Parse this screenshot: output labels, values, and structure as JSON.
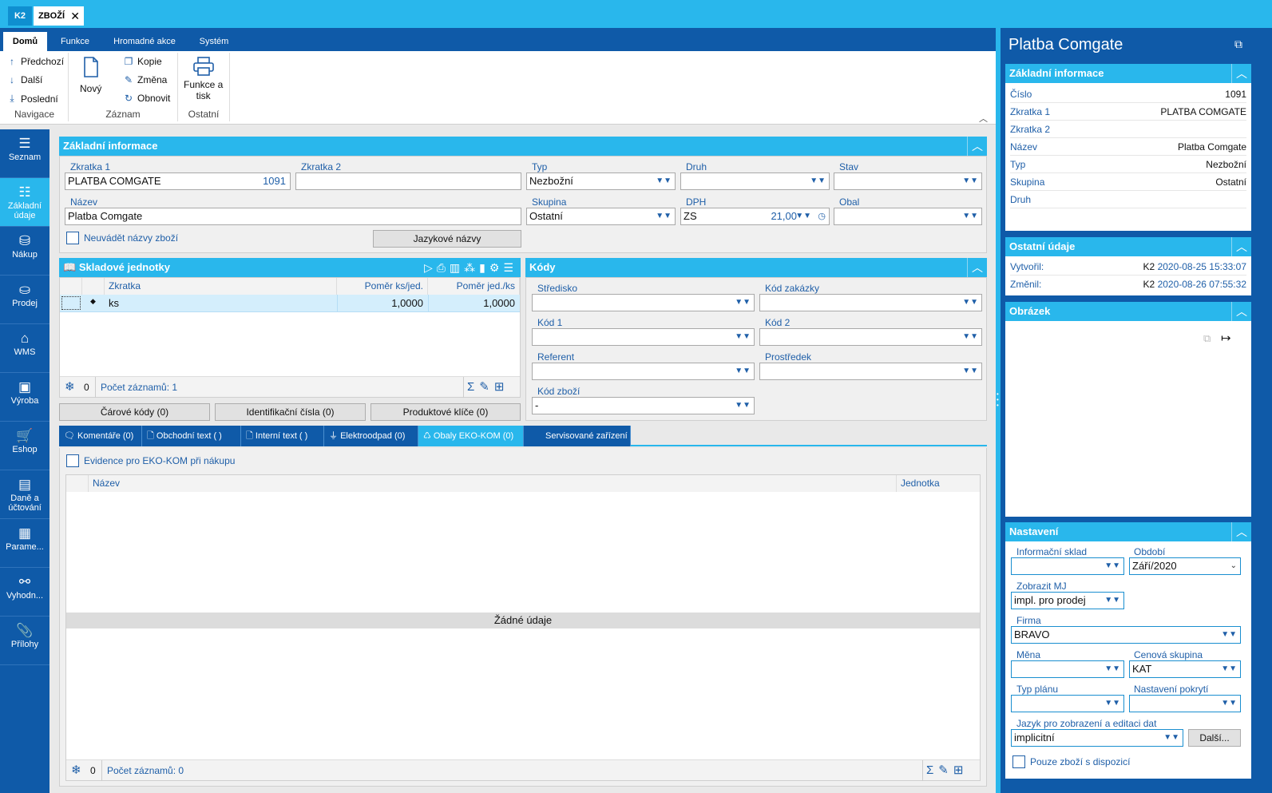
{
  "window_tabs": [
    {
      "label": "K2"
    },
    {
      "label": "ZBOŽÍ"
    }
  ],
  "ribbon": {
    "tabs": [
      "Domů",
      "Funkce",
      "Hromadné akce",
      "Systém"
    ],
    "nav": {
      "prev": "Předchozí",
      "next": "Další",
      "last": "Poslední",
      "group": "Navigace"
    },
    "record": {
      "new": "Nový",
      "copy": "Kopie",
      "change": "Změna",
      "refresh": "Obnovit",
      "group": "Záznam"
    },
    "other": {
      "print_line1": "Funkce a",
      "print_line2": "tisk",
      "group": "Ostatní"
    }
  },
  "nav": [
    {
      "label": "Seznam",
      "icon": "list-icon"
    },
    {
      "label": "Základní údaje",
      "icon": "list-detail-icon"
    },
    {
      "label": "Nákup",
      "icon": "purchase-icon"
    },
    {
      "label": "Prodej",
      "icon": "sale-icon"
    },
    {
      "label": "WMS",
      "icon": "warehouse-icon"
    },
    {
      "label": "Výroba",
      "icon": "production-icon"
    },
    {
      "label": "Eshop",
      "icon": "cart-icon"
    },
    {
      "label": "Daně a účtování",
      "icon": "accounting-icon"
    },
    {
      "label": "Parame...",
      "icon": "parameters-icon"
    },
    {
      "label": "Vyhodn...",
      "icon": "evaluation-icon"
    },
    {
      "label": "Přílohy",
      "icon": "attachment-icon"
    }
  ],
  "basic": {
    "title": "Základní informace",
    "zkratka1_label": "Zkratka 1",
    "zkratka1_value": "PLATBA COMGATE",
    "zkratka1_num": "1091",
    "zkratka2_label": "Zkratka 2",
    "typ_label": "Typ",
    "typ_value": "Nezbožní",
    "druh_label": "Druh",
    "stav_label": "Stav",
    "nazev_label": "Název",
    "nazev_value": "Platba Comgate",
    "skupina_label": "Skupina",
    "skupina_value": "Ostatní",
    "dph_label": "DPH",
    "dph_value": "ZS",
    "dph_rate": "21,00",
    "obal_label": "Obal",
    "neuvadet_label": "Neuvádět názvy zboží",
    "jazykove_btn": "Jazykové názvy"
  },
  "units": {
    "title": "Skladové jednotky",
    "columns": [
      "Zkratka",
      "Poměr ks/jed.",
      "Poměr jed./ks"
    ],
    "rows": [
      {
        "zkratka": "ks",
        "pomer1": "1,0000",
        "pomer2": "1,0000"
      }
    ],
    "count": "0",
    "records": "Počet záznamů: 1"
  },
  "buttons": {
    "carove": "Čárové kódy (0)",
    "ident": "Identifikační čísla (0)",
    "produkt": "Produktové klíče (0)"
  },
  "codes": {
    "title": "Kódy",
    "stredisko": "Středisko",
    "kod_zakazky": "Kód zakázky",
    "kod1": "Kód 1",
    "kod2": "Kód 2",
    "referent": "Referent",
    "prostredek": "Prostředek",
    "kod_zbozi": "Kód zboží",
    "kod_zbozi_value": "-"
  },
  "bottom_tabs": [
    "Komentáře (0)",
    "Obchodní text ( )",
    "Interní text ( )",
    "Elektroodpad (0)",
    "Obaly EKO-KOM (0)",
    "Servisované zařízení"
  ],
  "ekokom": {
    "evidence_label": "Evidence pro EKO-KOM při nákupu",
    "columns": [
      "Název",
      "Jednotka"
    ],
    "empty": "Žádné údaje",
    "count": "0",
    "records": "Počet záznamů: 0"
  },
  "right": {
    "title": "Platba Comgate",
    "basic_title": "Základní informace",
    "basic_rows": [
      {
        "k": "Číslo",
        "v": "1091"
      },
      {
        "k": "Zkratka 1",
        "v": "PLATBA COMGATE"
      },
      {
        "k": "Zkratka 2",
        "v": ""
      },
      {
        "k": "Název",
        "v": "Platba Comgate"
      },
      {
        "k": "Typ",
        "v": "Nezbožní"
      },
      {
        "k": "Skupina",
        "v": "Ostatní"
      },
      {
        "k": "Druh",
        "v": ""
      }
    ],
    "other_title": "Ostatní údaje",
    "created_label": "Vytvořil:",
    "created_user": "K2",
    "created_date": "2020-08-25 15:33:07",
    "changed_label": "Změnil:",
    "changed_user": "K2",
    "changed_date": "2020-08-26 07:55:32",
    "image_title": "Obrázek",
    "settings_title": "Nastavení",
    "info_sklad": "Informační sklad",
    "obdobi": "Období",
    "obdobi_value": "Září/2020",
    "zobrazit_mj": "Zobrazit MJ",
    "zobrazit_mj_value": "impl. pro prodej",
    "firma": "Firma",
    "firma_value": "BRAVO",
    "mena": "Měna",
    "cenova": "Cenová skupina",
    "cenova_value": "KAT",
    "typ_planu": "Typ plánu",
    "pokryti": "Nastavení pokrytí",
    "jazyk": "Jazyk pro zobrazení a editaci dat",
    "jazyk_value": "implicitní",
    "dalsi_btn": "Další...",
    "pouze_label": "Pouze zboží s dispozicí"
  }
}
